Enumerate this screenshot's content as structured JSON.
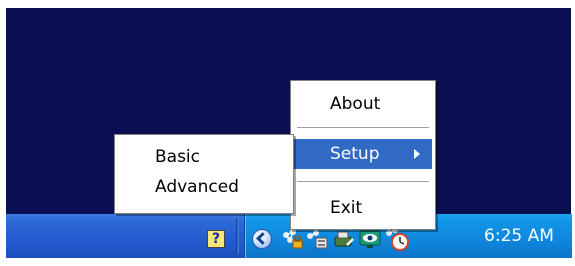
{
  "menu": {
    "items": [
      {
        "label": "About"
      },
      {
        "label": "Setup"
      },
      {
        "label": "Exit"
      }
    ]
  },
  "submenu": {
    "items": [
      {
        "label": "Basic"
      },
      {
        "label": "Advanced"
      }
    ]
  },
  "taskbar": {
    "clock": "6:25 AM",
    "help_icon_glyph": "?"
  },
  "colors": {
    "desktop": "#0a0f52",
    "taskbar": "#245bd0",
    "tray": "#0f86dc",
    "menu_highlight": "#316ac5"
  },
  "icons": [
    "help-icon",
    "chevron-icon",
    "network-icon",
    "lock-icon",
    "printer-icon",
    "wrench-icon",
    "eye-icon",
    "network-clock-icon"
  ]
}
